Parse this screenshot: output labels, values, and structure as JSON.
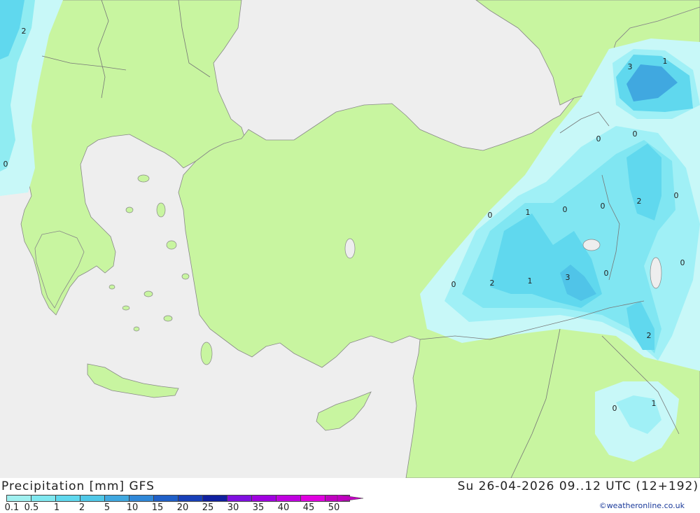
{
  "map": {
    "sea_color": "#eeeeee",
    "land_color": "#c8f5a0",
    "border_color": "#777777",
    "contour_labels": [
      {
        "id": "lbl-1",
        "text": "2"
      },
      {
        "id": "lbl-2",
        "text": "0"
      },
      {
        "id": "lbl-3",
        "text": "3"
      },
      {
        "id": "lbl-4",
        "text": "1"
      },
      {
        "id": "lbl-5",
        "text": "0"
      },
      {
        "id": "lbl-6",
        "text": "0"
      },
      {
        "id": "lbl-7",
        "text": "0"
      },
      {
        "id": "lbl-8",
        "text": "1"
      },
      {
        "id": "lbl-9",
        "text": "0"
      },
      {
        "id": "lbl-10",
        "text": "0"
      },
      {
        "id": "lbl-11",
        "text": "2"
      },
      {
        "id": "lbl-12",
        "text": "0"
      },
      {
        "id": "lbl-13",
        "text": "0"
      },
      {
        "id": "lbl-14",
        "text": "2"
      },
      {
        "id": "lbl-15",
        "text": "1"
      },
      {
        "id": "lbl-16",
        "text": "3"
      },
      {
        "id": "lbl-17",
        "text": "0"
      },
      {
        "id": "lbl-18",
        "text": "0"
      },
      {
        "id": "lbl-19",
        "text": "2"
      },
      {
        "id": "lbl-20",
        "text": "0"
      },
      {
        "id": "lbl-21",
        "text": "1"
      }
    ]
  },
  "footer": {
    "title": "Precipitation [mm] GFS",
    "timestamp": "Su 26-04-2026 09..12 UTC (12+192)",
    "credit": "©weatheronline.co.uk"
  },
  "legend": {
    "colors": [
      "#a0f0f0",
      "#80e8f0",
      "#60d8ee",
      "#50c8e8",
      "#40a8e0",
      "#3088d8",
      "#2060c8",
      "#1840b8",
      "#1020a0",
      "#8010e0",
      "#a000e0",
      "#c000e0",
      "#e000e0",
      "#c000c0"
    ],
    "labels": [
      "0.1",
      "0.5",
      "1",
      "2",
      "5",
      "10",
      "15",
      "20",
      "25",
      "30",
      "35",
      "40",
      "45",
      "50"
    ]
  }
}
